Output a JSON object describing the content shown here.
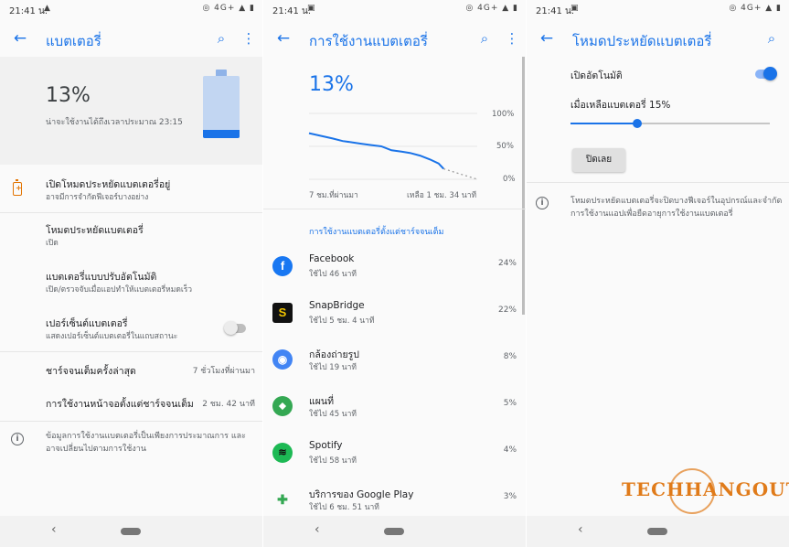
{
  "status_time": "21:41 น.",
  "status_icons": "◎ 4G+ ▲ ▮",
  "panel1": {
    "title": "แบตเตอรี่",
    "percent": "13%",
    "estimate": "น่าจะใช้งานได้ถึงเวลาประมาณ 23:15",
    "battery_level": 0.13,
    "rows": [
      {
        "title": "เปิดโหมดประหยัดแบตเตอรี่อยู่",
        "subtitle": "อาจมีการจำกัดฟีเจอร์บางอย่าง"
      },
      {
        "title": "โหมดประหยัดแบตเตอรี่",
        "subtitle": "เปิด"
      },
      {
        "title": "แบตเตอรี่แบบปรับอัตโนมัติ",
        "subtitle": "เปิด/ตรวจจับเมื่อแอปทำให้แบตเตอรี่หมดเร็ว"
      },
      {
        "title": "เปอร์เซ็นต์แบตเตอรี่",
        "subtitle": "แสดงเปอร์เซ็นต์แบตเตอรี่ในแถบสถานะ"
      }
    ],
    "last_full_charge_label": "ชาร์จจนเต็มครั้งล่าสุด",
    "last_full_charge_value": "7 ชั่วโมงที่ผ่านมา",
    "screen_usage_label": "การใช้งานหน้าจอตั้งแต่ชาร์จจนเต็ม",
    "screen_usage_value": "2 ชม. 42 นาที",
    "info": "ข้อมูลการใช้งานแบตเตอรี่เป็นเพียงการประมาณการ และอาจเปลี่ยนไปตามการใช้งาน"
  },
  "panel2": {
    "title": "การใช้งานแบตเตอรี่",
    "percent": "13%",
    "section_header": "การใช้งานแบตเตอรี่ตั้งแต่ชาร์จจนเต็ม",
    "apps": [
      {
        "name": "Facebook",
        "usage": "ใช้ไป 46 นาที",
        "percent": "24%",
        "icon": "facebook-icon",
        "color": "#1877f2",
        "glyph": "f"
      },
      {
        "name": "SnapBridge",
        "usage": "ใช้ไป 5 ชม. 4 นาที",
        "percent": "22%",
        "icon": "snapbridge-icon",
        "color": "#111111",
        "glyph": "S"
      },
      {
        "name": "กล้องถ่ายรูป",
        "usage": "ใช้ไป 19 นาที",
        "percent": "8%",
        "icon": "camera-icon",
        "color": "#4285f4",
        "glyph": "◉"
      },
      {
        "name": "แผนที่",
        "usage": "ใช้ไป 45 นาที",
        "percent": "5%",
        "icon": "maps-icon",
        "color": "#34a853",
        "glyph": "⬥"
      },
      {
        "name": "Spotify",
        "usage": "ใช้ไป 58 นาที",
        "percent": "4%",
        "icon": "spotify-icon",
        "color": "#1db954",
        "glyph": "≋"
      },
      {
        "name": "บริการของ Google Play",
        "usage": "ใช้ไป 6 ชม. 51 นาที",
        "percent": "3%",
        "icon": "google-play-services-icon",
        "color": "#ffffff",
        "glyph": "✚"
      }
    ]
  },
  "chart_data": {
    "type": "line",
    "x_start_label": "7 ชม.ที่ผ่านมา",
    "x_end_label": "เหลือ 1 ชม. 34 นาที",
    "y_ticks": [
      "100%",
      "50%",
      "0%"
    ],
    "ylim": [
      0,
      100
    ],
    "series": [
      {
        "x": [
          0,
          0.07,
          0.14,
          0.2,
          0.26,
          0.31,
          0.37,
          0.43,
          0.49,
          0.55,
          0.6,
          0.66,
          0.72,
          0.77,
          0.8
        ],
        "values": [
          70,
          66,
          62,
          58,
          56,
          54,
          52,
          50,
          44,
          42,
          40,
          36,
          30,
          24,
          16
        ]
      },
      {
        "x": [
          0.8,
          1.0
        ],
        "values": [
          16,
          0
        ],
        "style": "dashed"
      }
    ]
  },
  "panel3": {
    "title": "โหมดประหยัดแบตเตอรี่",
    "auto_on_label": "เปิดอัตโนมัติ",
    "threshold_label": "เมื่อเหลือแบตเตอรี่ 15%",
    "threshold_value": 0.15,
    "turn_off_button": "ปิดเลย",
    "note": "โหมดประหยัดแบตเตอรี่จะปิดบางฟีเจอร์ในอุปกรณ์และจำกัดการใช้งานแอปเพื่อยืดอายุการใช้งานแบตเตอรี่"
  },
  "watermark": "TECHHANGOUT"
}
